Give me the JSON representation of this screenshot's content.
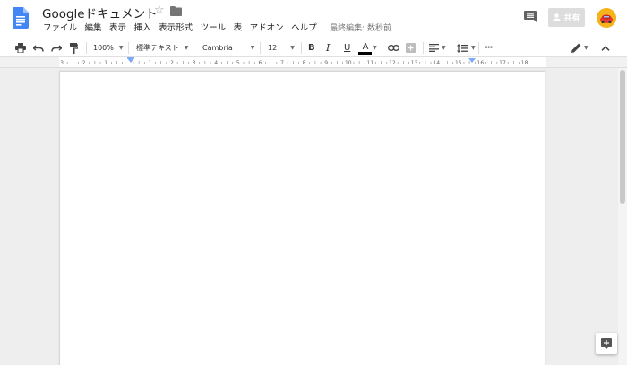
{
  "header": {
    "title": "Googleドキュメント",
    "last_edit": "最終編集: 数秒前",
    "share_label": "共有",
    "menus": [
      "ファイル",
      "編集",
      "表示",
      "挿入",
      "表示形式",
      "ツール",
      "表",
      "アドオン",
      "ヘルプ"
    ]
  },
  "toolbar": {
    "zoom": "100%",
    "style": "標準テキスト",
    "font": "Cambria",
    "size": "12",
    "bold": "B",
    "italic": "I",
    "underline": "U",
    "text_color": "A",
    "more": "···"
  },
  "ruler": {
    "labels": [
      "3",
      "2",
      "1",
      "",
      "1",
      "2",
      "3",
      "4",
      "5",
      "6",
      "7",
      "8",
      "9",
      "10",
      "11",
      "12",
      "13",
      "14",
      "15",
      "16",
      "17",
      "18"
    ]
  },
  "colors": {
    "doc_blue": "#4285f4",
    "avatar": "#f6b31b",
    "text_color_bar": "#000000",
    "indent_marker": "#7baaf7"
  },
  "icons": {
    "logo": "docs-logo-icon",
    "star": "star-icon",
    "folder": "folder-icon",
    "comments": "comments-icon",
    "person": "person-icon",
    "print": "print-icon",
    "undo": "undo-icon",
    "redo": "redo-icon",
    "paint_format": "paint-format-icon",
    "link": "link-icon",
    "insert_comment": "insert-comment-icon",
    "align": "align-left-icon",
    "line_spacing": "line-spacing-icon",
    "pencil": "pencil-icon",
    "collapse": "chevron-up-icon",
    "explore": "explore-icon"
  }
}
